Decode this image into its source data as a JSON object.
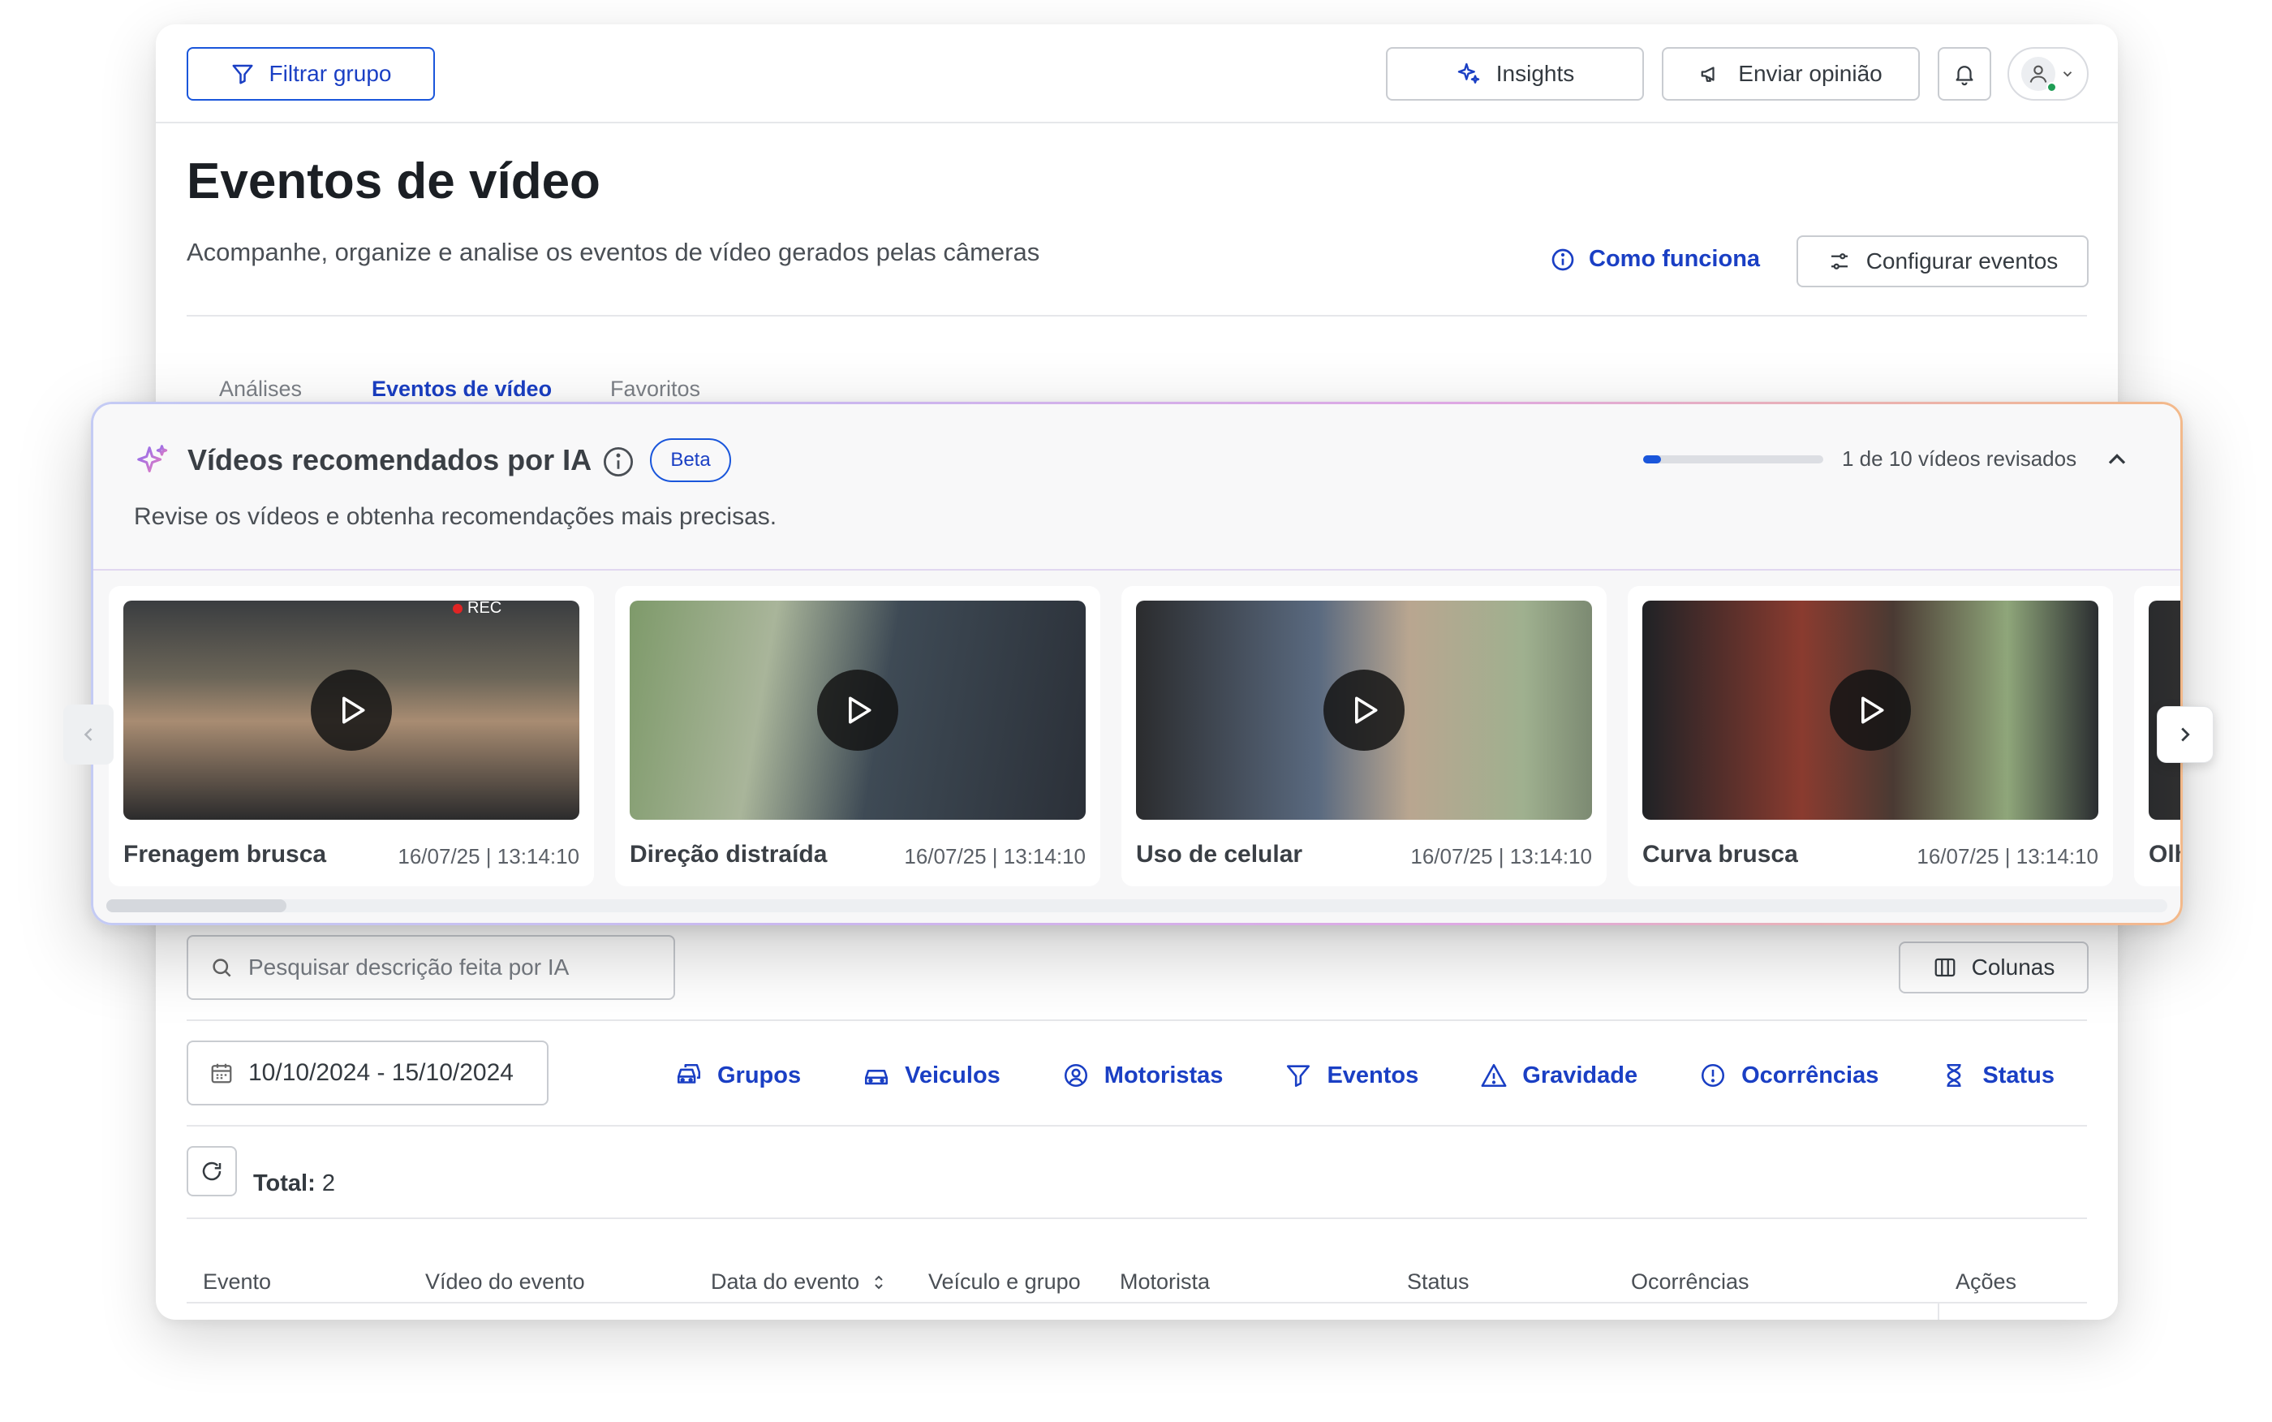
{
  "header": {
    "filter_group": "Filtrar grupo",
    "insights": "Insights",
    "feedback": "Enviar opinião"
  },
  "page": {
    "title": "Eventos de vídeo",
    "subtitle": "Acompanhe, organize e analise os eventos de vídeo gerados pelas câmeras",
    "how_it_works": "Como funciona",
    "configure": "Configurar eventos"
  },
  "tabs": [
    {
      "label": "Análises"
    },
    {
      "label": "Eventos de vídeo",
      "active": true
    },
    {
      "label": "Favoritos"
    }
  ],
  "ai_panel": {
    "title": "Vídeos recomendados por IA",
    "badge": "Beta",
    "subtitle": "Revise os vídeos e obtenha recomendações mais precisas.",
    "progress": 0.1,
    "progress_label": "1 de 10 vídeos revisados",
    "videos": [
      {
        "name": "Frenagem brusca",
        "date": "16/07/25 | 13:14:10"
      },
      {
        "name": "Direção distraída",
        "date": "16/07/25 | 13:14:10"
      },
      {
        "name": "Uso de celular",
        "date": "16/07/25 | 13:14:10"
      },
      {
        "name": "Curva brusca",
        "date": "16/07/25 | 13:14:10"
      },
      {
        "name": "Olh",
        "date": ""
      }
    ],
    "thumbnail_rec_label": "REC"
  },
  "toolbar": {
    "search_placeholder": "Pesquisar descrição feita por IA",
    "columns": "Colunas",
    "date_range": "10/10/2024 - 15/10/2024"
  },
  "filters": [
    {
      "label": "Grupos",
      "icon": "vehicle-group-icon"
    },
    {
      "label": "Veiculos",
      "icon": "car-icon"
    },
    {
      "label": "Motoristas",
      "icon": "user-circle-icon"
    },
    {
      "label": "Eventos",
      "icon": "filter-icon"
    },
    {
      "label": "Gravidade",
      "icon": "warning-icon"
    },
    {
      "label": "Ocorrências",
      "icon": "alert-circle-icon"
    },
    {
      "label": "Status",
      "icon": "hourglass-icon"
    }
  ],
  "summary": {
    "total_label": "Total:",
    "total_value": "2"
  },
  "table": {
    "columns": [
      "Evento",
      "Vídeo do evento",
      "Data do evento",
      "Veículo e grupo",
      "Motorista",
      "Status",
      "Ocorrências",
      "Ações"
    ]
  },
  "colors": {
    "accent": "#1a56db",
    "link": "#1a3fc4"
  }
}
